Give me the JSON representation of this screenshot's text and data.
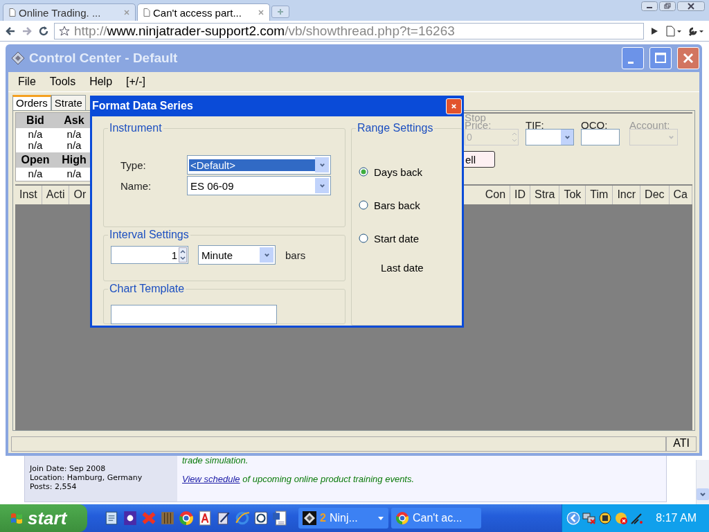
{
  "browser": {
    "tabs": [
      {
        "title": "Online Trading. ...",
        "selected": false
      },
      {
        "title": "Can't access part...",
        "selected": true
      }
    ],
    "address": {
      "scheme": "http://",
      "host": "www.ninjatrader-support2.com",
      "path": "/vb/showthread.php?t=16263"
    }
  },
  "page": {
    "member": [
      "Join Date: Sep 2008",
      "Location: Hamburg, Germany",
      "Posts: 2,554"
    ],
    "post": {
      "cut_line": "trade simulation.",
      "link": "View schedule",
      "rest": "of upcoming online product training events."
    }
  },
  "control_center": {
    "title": "Control Center - Default",
    "menu": [
      "File",
      "Tools",
      "Help",
      "[+/-]"
    ],
    "tabs": [
      {
        "label": "Orders",
        "selected": true
      },
      {
        "label": "Strate",
        "selected": false
      }
    ],
    "quote": {
      "header_1": [
        "Bid",
        "Ask"
      ],
      "rows_1": [
        [
          "n/a",
          "n/a"
        ],
        [
          "n/a",
          "n/a"
        ]
      ],
      "header_2": [
        "Open",
        "High"
      ],
      "rows_2": [
        [
          "n/a",
          "n/a"
        ]
      ]
    },
    "order_fields": [
      {
        "label": "Stop Price:",
        "kind": "spinner",
        "value": "0",
        "disabled": true
      },
      {
        "label": "TIF:",
        "kind": "dropdown",
        "disabled": false
      },
      {
        "label": "OCO:",
        "kind": "text",
        "disabled": false
      },
      {
        "label": "Account:",
        "kind": "dropdown",
        "disabled": true
      }
    ],
    "sell_button": "ell",
    "columns_left": [
      "Inst",
      "Acti",
      "Or"
    ],
    "columns_right": [
      "Con",
      "ID",
      "Stra",
      "Tok",
      "Tim",
      "Incr",
      "Dec",
      "Ca"
    ],
    "status_bar": {
      "panel": "ATI"
    }
  },
  "dialog": {
    "title": "Format Data Series",
    "instrument": {
      "title": "Instrument",
      "type_label": "Type:",
      "type_value": "<Default>",
      "name_label": "Name:",
      "name_value": "ES 06-09"
    },
    "interval": {
      "title": "Interval Settings",
      "value": "1",
      "unit": "Minute",
      "suffix": "bars"
    },
    "chart_template": {
      "title": "Chart Template"
    },
    "range": {
      "title": "Range Settings",
      "options": [
        {
          "label": "Days back",
          "selected": true
        },
        {
          "label": "Bars back",
          "selected": false
        },
        {
          "label": "Start date",
          "selected": false
        }
      ],
      "last_date": "Last date"
    }
  },
  "taskbar": {
    "start": "start",
    "tasks": [
      {
        "kind": "group",
        "count": "2",
        "label": "Ninj..."
      },
      {
        "kind": "single",
        "label": "Can't ac..."
      }
    ],
    "clock": "8:17 AM"
  }
}
